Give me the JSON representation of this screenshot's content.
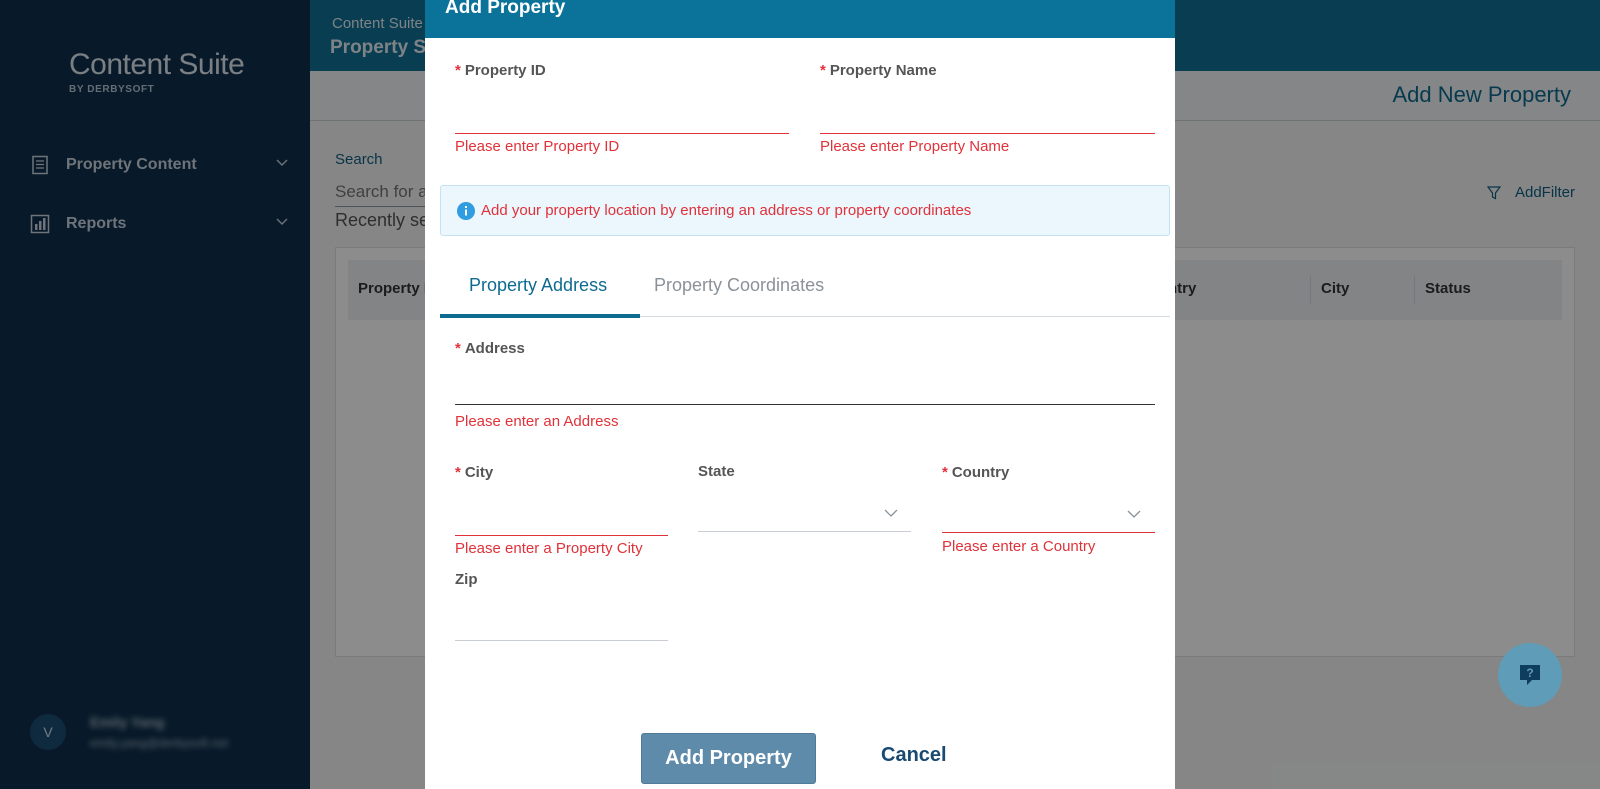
{
  "app": {
    "logo_main": "Content Suite",
    "logo_sub": "BY DERBYSOFT"
  },
  "sidebar": {
    "items": [
      {
        "label": "Property Content",
        "icon": "document-icon"
      },
      {
        "label": "Reports",
        "icon": "bar-chart-icon"
      }
    ],
    "user": {
      "initial": "V",
      "name": "Emily Yang",
      "email": "emily.yang@derbysoft.net"
    }
  },
  "header": {
    "crumb_parent": "Content Suite",
    "crumb_current": "Property Se",
    "add_new": "Add New Property"
  },
  "main": {
    "search_label": "Search",
    "search_placeholder": "Search for a",
    "recently": "Recently se",
    "add_filter": "AddFilter",
    "columns": [
      "Property I",
      "ntry",
      "City",
      "Status"
    ]
  },
  "modal": {
    "title": "Add Property",
    "property_id_label": "Property ID",
    "property_id_error": "Please enter Property ID",
    "property_name_label": "Property Name",
    "property_name_error": "Please enter Property Name",
    "info_text": "Add your property location by entering an address or property coordinates",
    "tabs": [
      {
        "label": "Property Address",
        "active": true
      },
      {
        "label": "Property Coordinates",
        "active": false
      }
    ],
    "address_label": "Address",
    "address_error": "Please enter an Address",
    "city_label": "City",
    "city_error": "Please enter a Property City",
    "state_label": "State",
    "country_label": "Country",
    "country_error": "Please enter a Country",
    "zip_label": "Zip",
    "required_mark": "*",
    "submit_label": "Add Property",
    "cancel_label": "Cancel"
  },
  "colors": {
    "sidebar": "#0f2f4b",
    "topbar": "#116f94",
    "accent": "#0e6b90",
    "error": "#e0323a",
    "primary_button": "#5f8bab"
  }
}
